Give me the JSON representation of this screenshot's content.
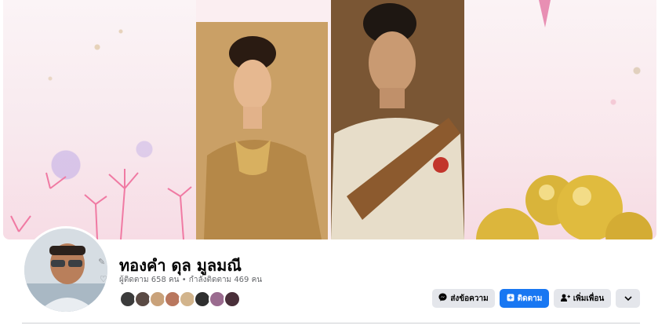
{
  "profile": {
    "name": "ทองคำ ดุล มูลมณี",
    "stats": "ผู้ติดตาม 658 คน • กำลังติดตาม 469 คน"
  },
  "actions": {
    "message_label": "ส่งข้อความ",
    "follow_label": "ติดตาม",
    "add_friend_label": "เพิ่มเพื่อน"
  },
  "friends": [
    {
      "color": "#3b3b3b"
    },
    {
      "color": "#5a4a44"
    },
    {
      "color": "#c9a27a"
    },
    {
      "color": "#b9775e"
    },
    {
      "color": "#d2b48c"
    },
    {
      "color": "#2f2f2f"
    },
    {
      "color": "#9a6b8f"
    },
    {
      "color": "#4a2f3a"
    }
  ],
  "icons": {
    "messenger": "messenger-icon",
    "follow": "follow-icon",
    "add_friend": "add-friend-icon",
    "more": "chevron-down-icon"
  },
  "colors": {
    "primary": "#1877f2",
    "secondary_button": "#e4e6eb",
    "text_primary": "#050505",
    "text_secondary": "#65676b"
  }
}
